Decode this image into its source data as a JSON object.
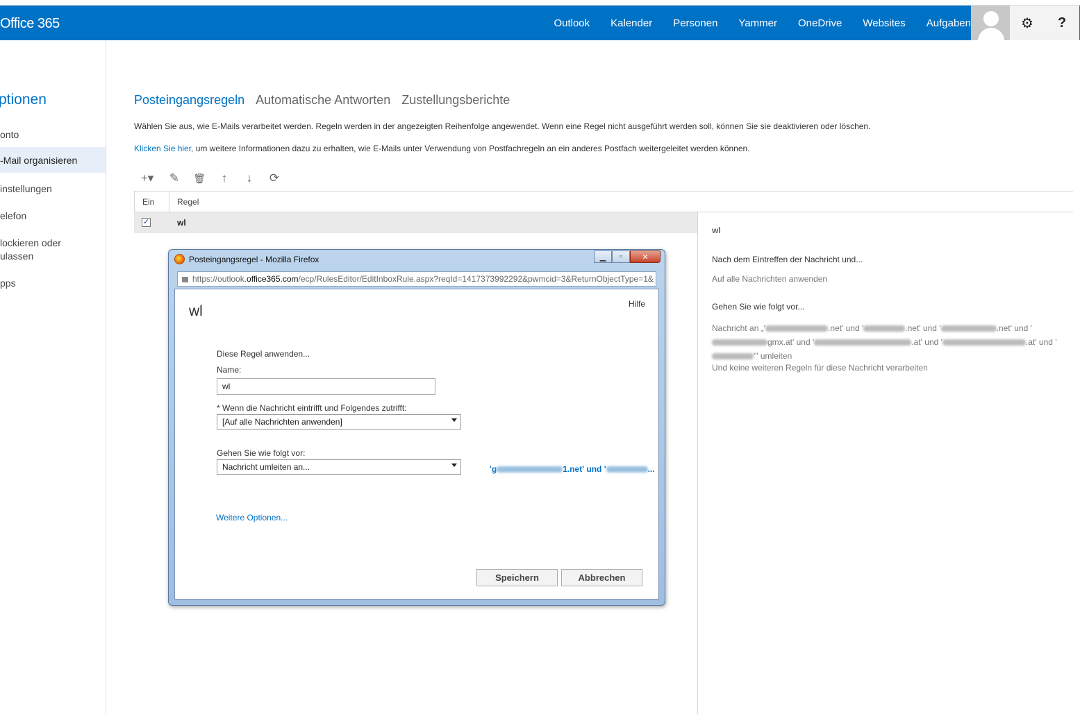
{
  "header": {
    "brand": "Office 365",
    "nav": [
      "Outlook",
      "Kalender",
      "Personen",
      "Yammer",
      "OneDrive",
      "Websites",
      "Aufgaben"
    ],
    "gear_icon": "⚙",
    "help_icon": "?"
  },
  "sidebar": {
    "title": "ptionen",
    "items": [
      {
        "label": "onto"
      },
      {
        "label": "-Mail organisieren"
      },
      {
        "label": "instellungen"
      },
      {
        "label": "elefon"
      },
      {
        "label": "lockieren oder\nulassen"
      },
      {
        "label": "pps"
      }
    ]
  },
  "tabs": [
    "Posteingangsregeln",
    "Automatische Antworten",
    "Zustellungsberichte"
  ],
  "description": {
    "line1": "Wählen Sie aus, wie E-Mails verarbeitet werden. Regeln werden in der angezeigten Reihenfolge angewendet. Wenn eine Regel nicht ausgeführt werden soll, können Sie sie deaktivieren oder löschen.",
    "link": "Klicken Sie hier",
    "line2": ", um weitere Informationen dazu zu erhalten, wie E-Mails unter Verwendung von Postfachregeln an ein anderes Postfach weitergeleitet werden können."
  },
  "toolbar": {
    "add": "+▾",
    "edit": "✎",
    "delete": "🗑",
    "up": "↑",
    "down": "↓",
    "refresh": "⟳"
  },
  "grid": {
    "col_on": "Ein",
    "col_rule": "Regel",
    "rows": [
      {
        "checked": "✓",
        "name": "wl"
      }
    ]
  },
  "details": {
    "title": "wl",
    "cond_heading": "Nach dem Eintreffen der Nachricht und...",
    "cond_value": "Auf alle Nachrichten anwenden",
    "action_heading": "Gehen Sie wie folgt vor...",
    "action_a": "Nachricht an „'",
    "action_b": ".net' und '",
    "action_c": ".net' und '",
    "action_d": ".net' und '",
    "action_e": "gmx.at' und '",
    "action_f": ".at' und '",
    "action_g": ".at' und '",
    "action_h": "'\" umleiten",
    "stop": "Und keine weiteren Regeln für diese Nachricht verarbeiten"
  },
  "dialog": {
    "window_title": "Posteingangsregel - Mozilla Firefox",
    "url_prefix": "https://outlook.",
    "url_domain": "office365.com",
    "url_rest": "/ecp/RulesEditor/EditInboxRule.aspx?reqId=1417373992292&pwmcid=3&ReturnObjectType=1&",
    "heading": "wl",
    "help": "Hilfe",
    "apply_label": "Diese Regel anwenden...",
    "name_label": "Name:",
    "name_value": "wl",
    "when_label": "* Wenn die Nachricht eintrifft und Folgendes zutrifft:",
    "when_value": "[Auf alle Nachrichten anwenden]",
    "do_label": "Gehen Sie wie folgt vor:",
    "do_value": "Nachricht umleiten an...",
    "recipients": "'g",
    "recipients_mid": "1.net' und '",
    "recipients_end": "...",
    "more_options": "Weitere Optionen...",
    "save": "Speichern",
    "cancel": "Abbrechen"
  }
}
